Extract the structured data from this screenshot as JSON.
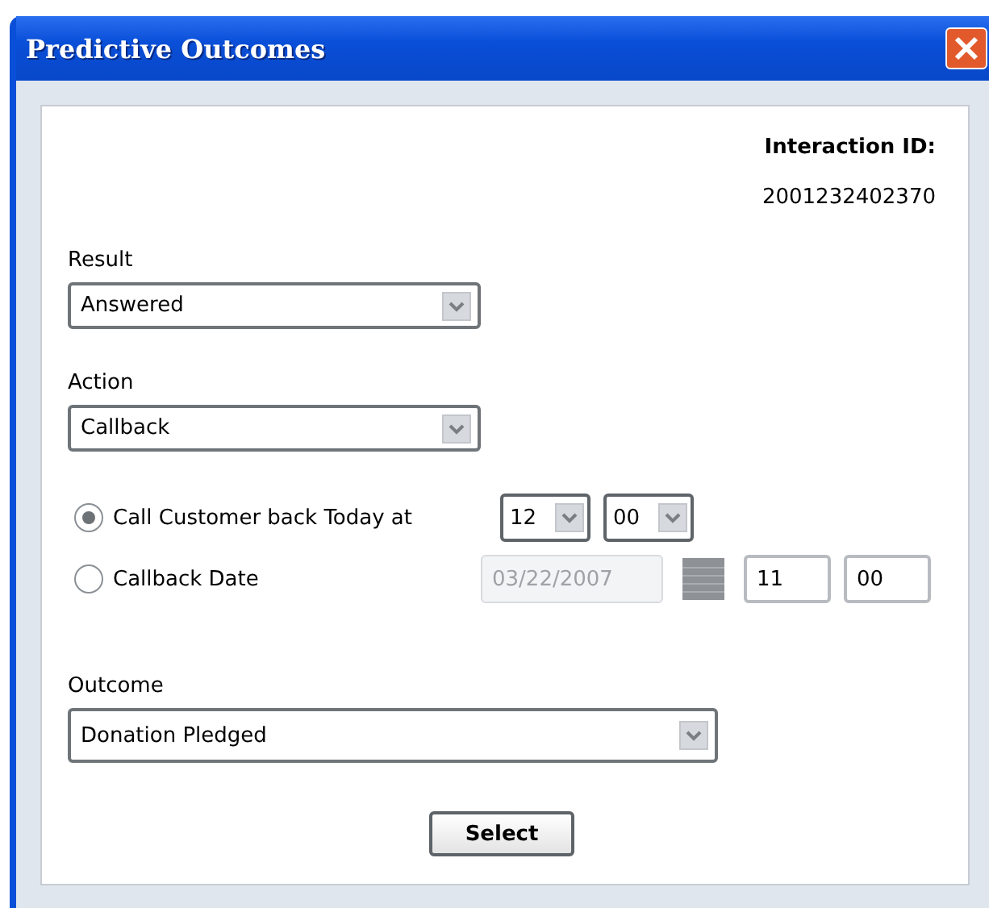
{
  "window": {
    "title": "Predictive Outcomes"
  },
  "interaction": {
    "label": "Interaction ID:",
    "value": "2001232402370"
  },
  "result": {
    "label": "Result",
    "value": "Answered"
  },
  "action": {
    "label": "Action",
    "value": "Callback"
  },
  "callback_options": [
    {
      "label": "Call Customer back Today at",
      "selected": true,
      "fields": [
        {
          "kind": "select",
          "value": "12",
          "disabled": false
        },
        {
          "kind": "select",
          "value": "00",
          "disabled": false
        }
      ]
    },
    {
      "label": "Callback Date",
      "selected": false,
      "fields": [
        {
          "kind": "date",
          "value": "03/22/2007",
          "disabled": true
        },
        {
          "kind": "text",
          "value": "11",
          "disabled": false
        },
        {
          "kind": "text",
          "value": "00",
          "disabled": false
        }
      ]
    }
  ],
  "outcome": {
    "label": "Outcome",
    "value": "Donation Pledged"
  },
  "buttons": [
    "Select"
  ]
}
